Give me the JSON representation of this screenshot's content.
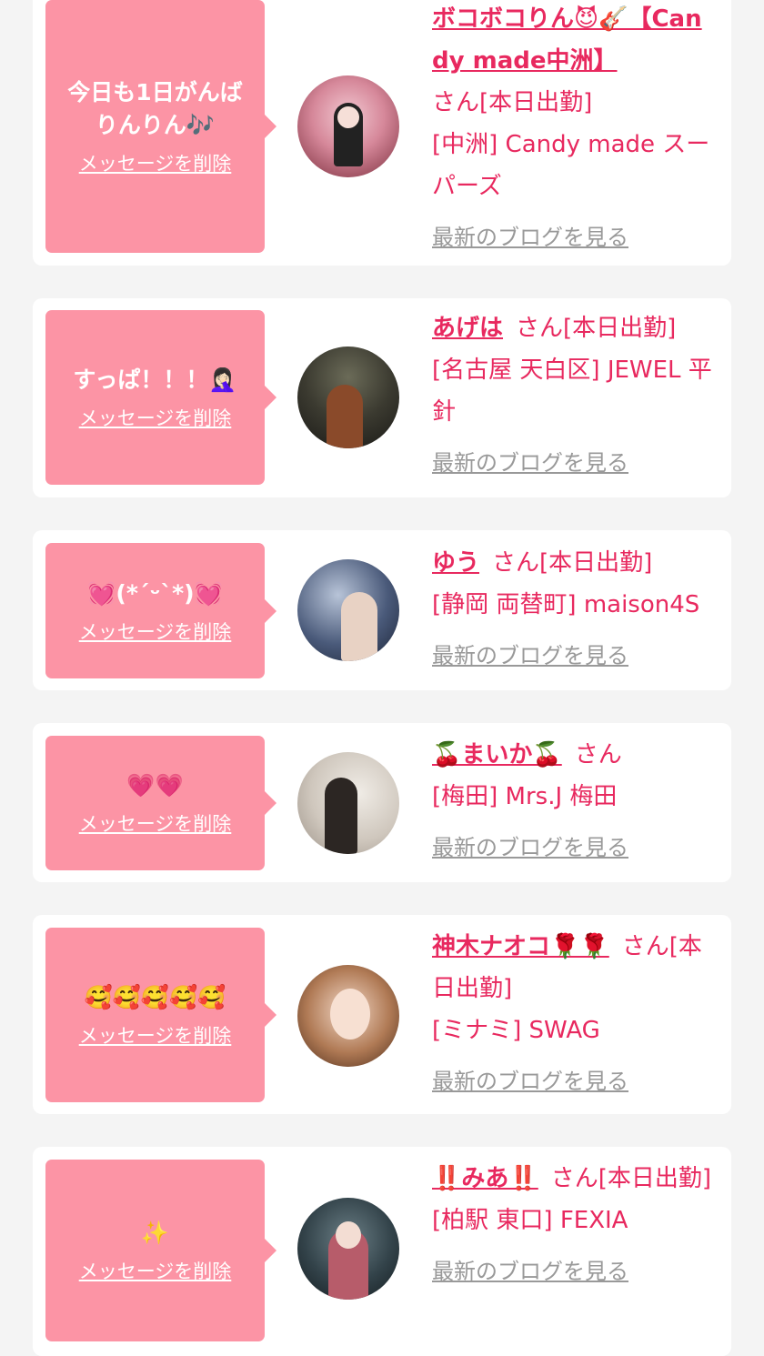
{
  "colors": {
    "accent": "#e8295f",
    "bubble": "#fc94a5",
    "link_gray": "#999999",
    "background": "#f4f4f4"
  },
  "delete_label": "メッセージを削除",
  "blog_label": "最新のブログを見る",
  "items": [
    {
      "message": "今日も1日がんばりんりん🎶",
      "name": "ボコボコりん😈🎸【Candy made中洲】",
      "suffix": "さん[本日出勤]",
      "shop": "[中洲] Candy made スーパーズ"
    },
    {
      "message": "すっぱ！！！🤦🏻‍♀️",
      "name": "あげは",
      "suffix": "さん[本日出勤]",
      "shop": "[名古屋 天白区] JEWEL 平針"
    },
    {
      "message": "💓(*´ᵕ`*)💓",
      "name": "ゆう",
      "suffix": "さん[本日出勤]",
      "shop": "[静岡 両替町] maison4S"
    },
    {
      "message": "💗💗",
      "name": "🍒まいか🍒",
      "suffix": "さん",
      "shop": "[梅田] Mrs.J 梅田"
    },
    {
      "message": "🥰🥰🥰🥰🥰",
      "name": "神木ナオコ🌹🌹",
      "suffix": "さん[本日出勤]",
      "shop": "[ミナミ] SWAG"
    },
    {
      "message": "✨",
      "name": "‼️みあ‼️",
      "suffix": "さん[本日出勤]",
      "shop": "[柏駅 東口] FEXIA"
    }
  ]
}
